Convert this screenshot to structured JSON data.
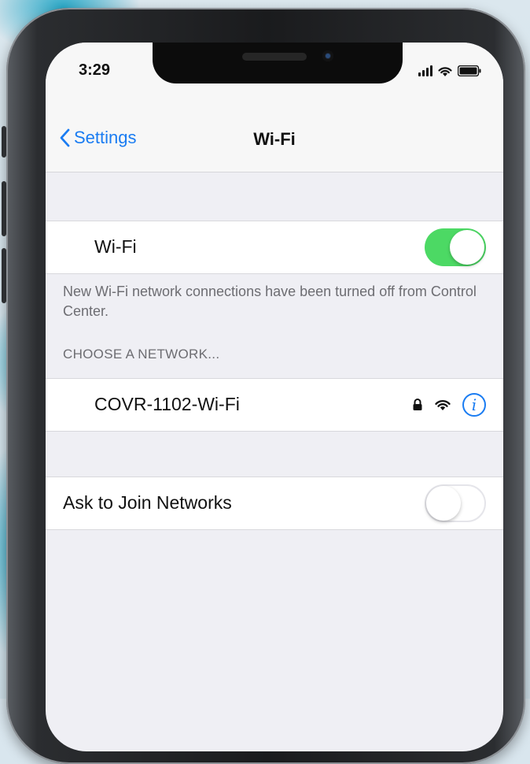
{
  "status_bar": {
    "time": "3:29"
  },
  "nav": {
    "back_label": "Settings",
    "title": "Wi-Fi"
  },
  "wifi_row": {
    "label": "Wi-Fi",
    "toggle_on": true
  },
  "note": "New Wi-Fi network connections have been turned off from Control Center.",
  "networks": {
    "header": "CHOOSE A NETWORK...",
    "items": [
      {
        "name": "COVR-1102-Wi-Fi",
        "secured": true,
        "icons": [
          "lock-icon",
          "wifi-signal-icon",
          "info-icon"
        ]
      }
    ]
  },
  "ask_join": {
    "label": "Ask to Join Networks",
    "toggle_on": false
  },
  "colors": {
    "accent": "#1a7cf2",
    "toggle_on": "#4cd964",
    "group_bg": "#efeff4"
  }
}
